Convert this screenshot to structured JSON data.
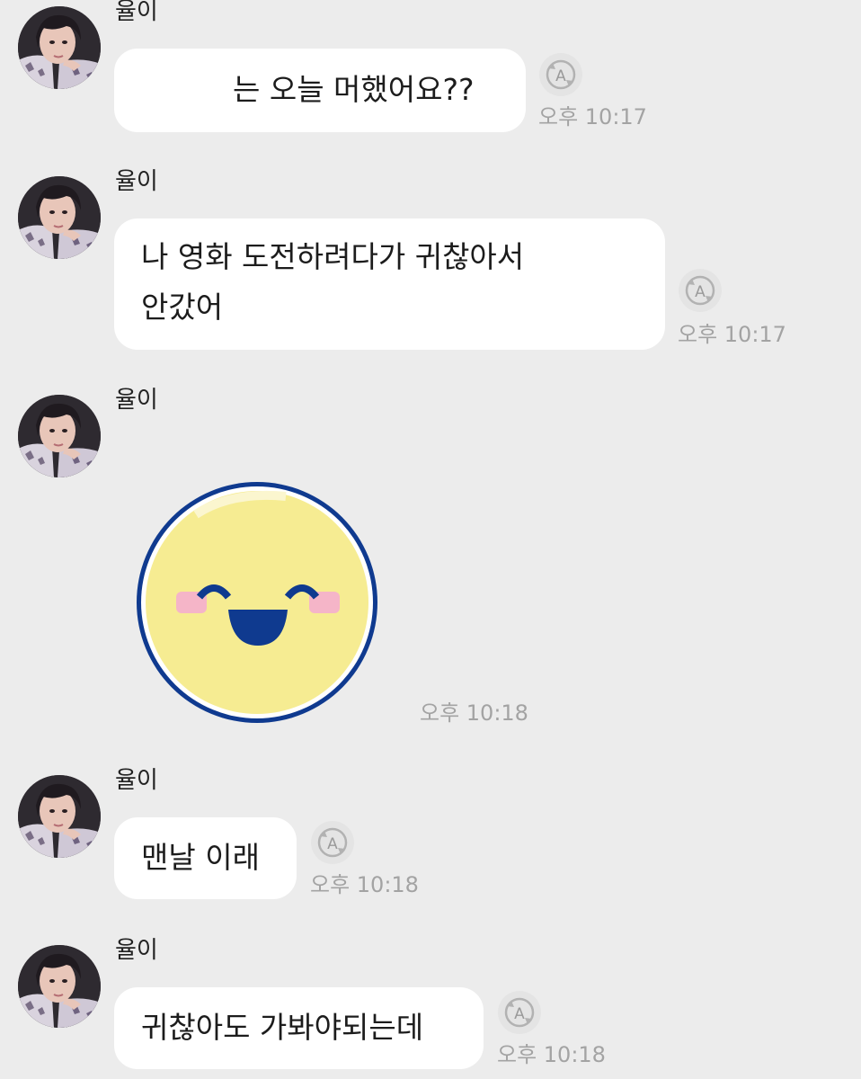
{
  "chat": {
    "messages": [
      {
        "sender": "율이",
        "text": "는 오늘 머했어요??",
        "time": "오후 10:17"
      },
      {
        "sender": "율이",
        "line1": "나 영화 도전하려다가 귀찮아서",
        "line2": "안갔어",
        "time": "오후 10:17"
      },
      {
        "sender": "율이",
        "sticker": "smiling-face-sticker",
        "time": "오후 10:18"
      },
      {
        "sender": "율이",
        "text": "맨날 이래",
        "time": "오후 10:18"
      },
      {
        "sender": "율이",
        "text": "귀찮아도 가봐야되는데",
        "time": "오후 10:18"
      }
    ]
  },
  "colors": {
    "background": "#ececec",
    "bubble": "#ffffff",
    "time_text": "#a3a3a3",
    "sticker_face": "#f6ec92",
    "sticker_outline": "#0f3a8f",
    "sticker_cheek": "#f5b5c8"
  },
  "icons": {
    "relay": "auto-translate-icon"
  }
}
